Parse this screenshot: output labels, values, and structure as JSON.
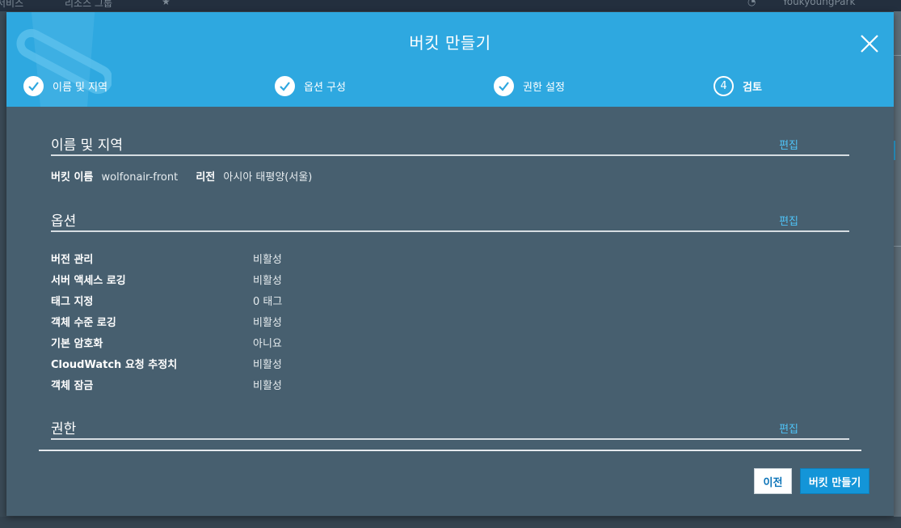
{
  "background": {
    "topbar": {
      "left_menu_1": "서비스",
      "left_menu_2": "리소스 그룹",
      "user_name": "YoukyoungPark"
    }
  },
  "modal": {
    "title": "버킷 만들기",
    "steps": [
      {
        "label": "이름 및 지역",
        "state": "done"
      },
      {
        "label": "옵션 구성",
        "state": "done"
      },
      {
        "label": "권한 설정",
        "state": "done"
      },
      {
        "label": "검토",
        "number": "4",
        "state": "current"
      }
    ],
    "sections": {
      "name_region": {
        "title": "이름 및 지역",
        "edit": "편집",
        "bucket_name_label": "버킷 이름",
        "bucket_name_value": "wolfonair-front",
        "region_label": "리전",
        "region_value": "아시아 태평양(서울)"
      },
      "options": {
        "title": "옵션",
        "edit": "편집",
        "rows": [
          {
            "key": "버전 관리",
            "value": "비활성"
          },
          {
            "key": "서버 액세스 로깅",
            "value": "비활성"
          },
          {
            "key": "태그 지정",
            "value": "0 태그"
          },
          {
            "key": "객체 수준 로깅",
            "value": "비활성"
          },
          {
            "key": "기본 암호화",
            "value": "아니요"
          },
          {
            "key": "CloudWatch 요청 추정치",
            "value": "비활성"
          },
          {
            "key": "객체 잠금",
            "value": "비활성"
          }
        ]
      },
      "permissions": {
        "title": "권한",
        "edit": "편집"
      }
    },
    "buttons": {
      "previous": "이전",
      "create": "버킷 만들기"
    }
  },
  "colors": {
    "header_blue": "#2ea8e0",
    "modal_body": "#475f6f",
    "link": "#4fc3f7",
    "primary_button": "#1395d8"
  }
}
